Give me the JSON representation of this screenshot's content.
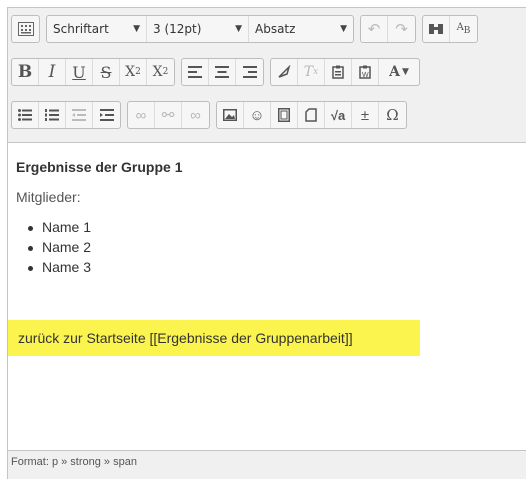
{
  "toolbar": {
    "font_family": "Schriftart",
    "font_size": "3 (12pt)",
    "paragraph_format": "Absatz",
    "icons_row1": [
      "toolbar-toggle-icon",
      "undo-icon",
      "redo-icon",
      "find-icon",
      "find-replace-icon"
    ],
    "icons_row2": [
      "bold-icon",
      "italic-icon",
      "underline-icon",
      "strikethrough-icon",
      "subscript-icon",
      "superscript-icon",
      "align-left-icon",
      "align-center-icon",
      "align-right-icon",
      "clear-formatting-icon",
      "remove-format-icon",
      "paste-text-icon",
      "paste-word-icon",
      "font-color-icon"
    ],
    "icons_row3": [
      "bulleted-list-icon",
      "numbered-list-icon",
      "outdent-icon",
      "indent-icon",
      "link-icon",
      "unlink-icon",
      "anchor-icon",
      "image-icon",
      "emoticon-icon",
      "media-icon",
      "manage-files-icon",
      "equation-icon",
      "insert-char-icon",
      "special-char-icon"
    ]
  },
  "content": {
    "heading": "Ergebnisse der Gruppe 1",
    "members_label": "Mitglieder:",
    "names": [
      "Name 1",
      "Name 2",
      "Name 3"
    ],
    "highlight_text": "zurück zur Startseite [[Ergebnisse der Gruppenarbeit]]",
    "highlight_color": "#fbf44f"
  },
  "status": {
    "path": "Format: p » strong » span"
  }
}
